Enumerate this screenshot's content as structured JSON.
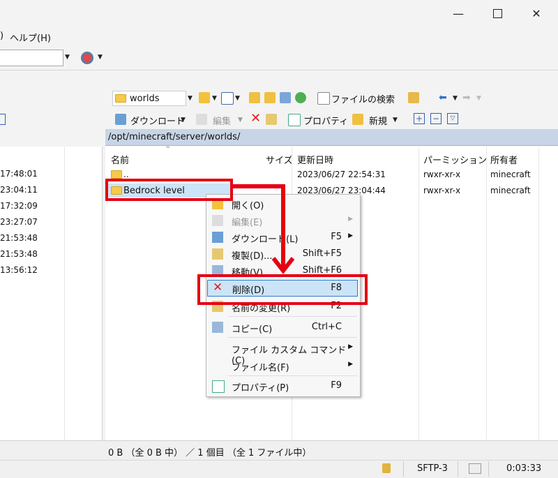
{
  "menu": {
    "help": "ヘルプ(H)",
    "paren": ")"
  },
  "toolbar_top": {
    "folder_combo": "worlds",
    "search": "ファイルの検索"
  },
  "toolbar_actions": {
    "download": "ダウンロード",
    "edit": "編集",
    "properties": "プロパティ",
    "new": "新規"
  },
  "path": "/opt/minecraft/server/worlds/",
  "columns": {
    "name": "名前",
    "size": "サイズ",
    "modified": "更新日時",
    "permissions": "パーミッション",
    "owner": "所有者"
  },
  "files": [
    {
      "name": "..",
      "modified": "2023/06/27 22:54:31",
      "permissions": "rwxr-xr-x",
      "owner": "minecraft"
    },
    {
      "name": "Bedrock level",
      "modified": "2023/06/27 23:04:44",
      "permissions": "rwxr-xr-x",
      "owner": "minecraft"
    }
  ],
  "left_times": [
    "17:48:01",
    "23:04:11",
    "17:32:09",
    "23:27:07",
    "21:53:48",
    "21:53:48",
    "13:56:12"
  ],
  "context_menu": {
    "open": "開く(O)",
    "edit": "編集(E)",
    "download": "ダウンロード(L)",
    "download_key": "F5",
    "duplicate": "複製(D)...",
    "duplicate_key": "Shift+F5",
    "move": "移動(V)...",
    "move_key": "Shift+F6",
    "delete": "削除(D)",
    "delete_key": "F8",
    "rename": "名前の変更(R)",
    "rename_key": "F2",
    "copy": "コピー(C)",
    "copy_key": "Ctrl+C",
    "custom_cmd": "ファイル カスタム コマンド(C)",
    "filename": "ファイル名(F)",
    "properties": "プロパティ(P)",
    "properties_key": "F9"
  },
  "status": {
    "selection": "0 B （全 0 B 中） ／ 1 個目 （全 1 ファイル中）",
    "protocol": "SFTP-3",
    "elapsed": "0:03:33"
  },
  "colors": {
    "highlight": "#cce4f7",
    "annotation": "#e50012",
    "pathbar": "#c7d5e6"
  }
}
